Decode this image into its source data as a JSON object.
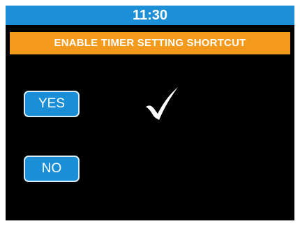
{
  "status_bar": {
    "time": "11:30",
    "background_color": "#1c8fd6"
  },
  "banner": {
    "title": "ENABLE TIMER SETTING SHORTCUT",
    "background_color": "#f39a1d"
  },
  "options": {
    "yes_label": "YES",
    "no_label": "NO",
    "selected": "YES",
    "button_color": "#1a8fd8"
  },
  "selection_indicator": {
    "icon": "checkmark-icon",
    "color": "#ffffff"
  }
}
